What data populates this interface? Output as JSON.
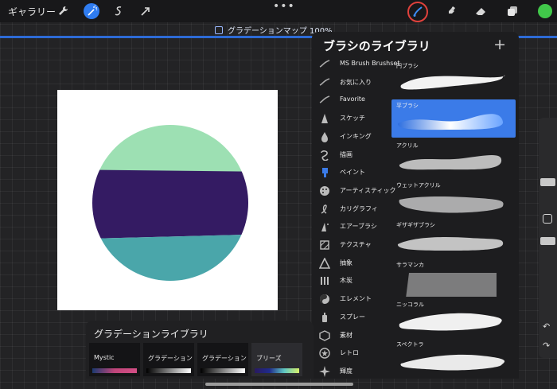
{
  "topbar": {
    "gallery_label": "ギャラリー",
    "tools_left": [
      "wrench-icon",
      "magic-wand-icon",
      "selection-icon",
      "transform-arrow-icon"
    ],
    "more_label": "•••",
    "tools_right": [
      "brush-icon",
      "smudge-icon",
      "eraser-icon",
      "layers-icon"
    ],
    "active_color": "#41c84a"
  },
  "document": {
    "title": "グラデーションマップ 100%"
  },
  "artwork": {
    "band_colors": [
      "#9de0b3",
      "#341b63",
      "#4aa6aa"
    ]
  },
  "brush_library": {
    "title": "ブラシのライブラリ",
    "add_label": "+",
    "categories": [
      {
        "label": "MS Brush Brushset",
        "icon": "stroke-icon"
      },
      {
        "label": "お気に入り",
        "icon": "stroke-icon"
      },
      {
        "label": "Favorite",
        "icon": "stroke-icon"
      },
      {
        "label": "スケッチ",
        "icon": "pencil-tip-icon"
      },
      {
        "label": "インキング",
        "icon": "ink-drop-icon"
      },
      {
        "label": "描画",
        "icon": "curl-icon"
      },
      {
        "label": "ペイント",
        "icon": "paint-brush-icon"
      },
      {
        "label": "アーティスティック",
        "icon": "palette-icon"
      },
      {
        "label": "カリグラフィ",
        "icon": "calligraphy-icon"
      },
      {
        "label": "エアーブラシ",
        "icon": "airbrush-icon"
      },
      {
        "label": "テクスチャ",
        "icon": "texture-icon"
      },
      {
        "label": "抽象",
        "icon": "triangle-icon"
      },
      {
        "label": "木炭",
        "icon": "charcoal-icon"
      },
      {
        "label": "エレメント",
        "icon": "yin-yang-icon"
      },
      {
        "label": "スプレー",
        "icon": "spray-can-icon"
      },
      {
        "label": "素材",
        "icon": "cube-icon"
      },
      {
        "label": "レトロ",
        "icon": "star-badge-icon"
      },
      {
        "label": "輝度",
        "icon": "sparkle-icon"
      }
    ],
    "selected_category": 2,
    "brushes": [
      {
        "name": "円ブラシ"
      },
      {
        "name": "平ブラシ"
      },
      {
        "name": "アクリル"
      },
      {
        "name": "ウェットアクリル"
      },
      {
        "name": "ギザギザブラシ"
      },
      {
        "name": "サラマンカ"
      },
      {
        "name": "ニッコラル"
      },
      {
        "name": "スペクトラ"
      }
    ],
    "selected_brush": 1
  },
  "sidebar": {
    "undo_label": "↶",
    "redo_label": "↷"
  },
  "gradient_library": {
    "title": "グラデーションライブラリ",
    "gradients": [
      {
        "name": "Mystic",
        "colors": [
          "#1b3a70",
          "#c0457a",
          "#d44f86"
        ]
      },
      {
        "name": "グラデーション",
        "colors": [
          "#000000",
          "#ffffff"
        ]
      },
      {
        "name": "グラデーション",
        "colors": [
          "#000000",
          "#ffffff"
        ]
      },
      {
        "name": "ブリーズ",
        "colors": [
          "#2a1a5e",
          "#1f2b8c",
          "#5fc6c2",
          "#d6f06a"
        ]
      }
    ],
    "selected_index": 3
  }
}
